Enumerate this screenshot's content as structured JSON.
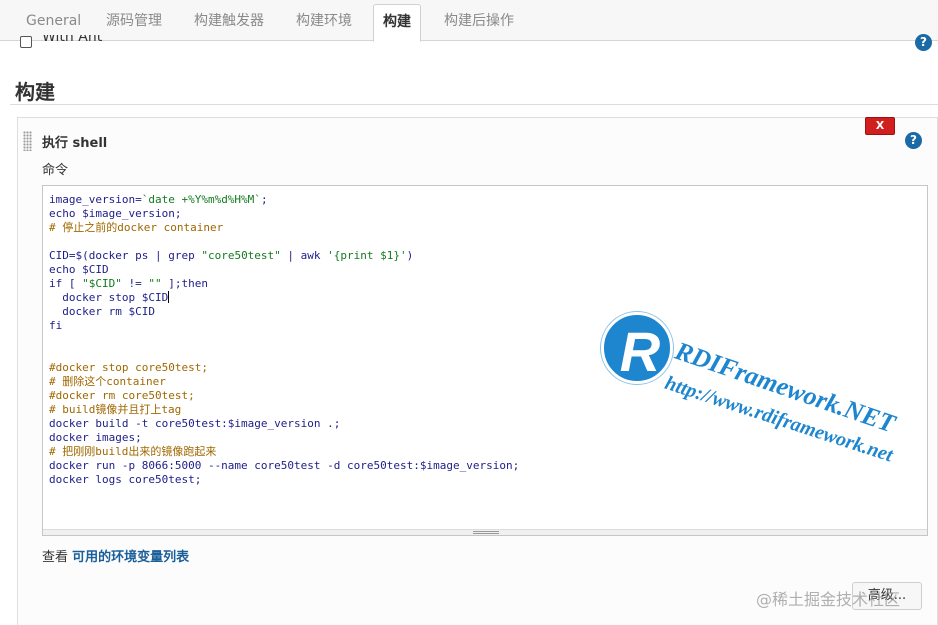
{
  "tabs": [
    {
      "label": "General"
    },
    {
      "label": "源码管理"
    },
    {
      "label": "构建触发器"
    },
    {
      "label": "构建环境"
    },
    {
      "label": "构建"
    },
    {
      "label": "构建后操作"
    }
  ],
  "active_tab": "构建",
  "ant_option": {
    "label": "With Ant",
    "checked": false
  },
  "help_icon": "?",
  "section_title": "构建",
  "build_step": {
    "title": "执行 shell",
    "delete_label": "X",
    "command_label": "命令",
    "command_lines": [
      "image_version=`date +%Y%m%d%H%M`;",
      "echo $image_version;",
      "# 停止之前的docker container",
      "",
      "CID=$(docker ps | grep \"core50test\" | awk '{print $1}')",
      "echo $CID",
      "if [ \"$CID\" != \"\" ];then",
      "  docker stop $CID",
      "  docker rm $CID",
      "fi",
      "",
      "",
      "#docker stop core50test;",
      "# 删除这个container",
      "#docker rm core50test;",
      "# build镜像并且打上tag",
      "docker build -t core50test:$image_version .;",
      "docker images;",
      "# 把刚刚build出来的镜像跑起来",
      "docker run -p 8066:5000 --name core50test -d core50test:$image_version;",
      "docker logs core50test;"
    ],
    "env_prefix": "查看 ",
    "env_link": "可用的环境变量列表",
    "advanced_label": "高级..."
  },
  "watermark": {
    "logo_letter": "R",
    "logo_text": "RDIFramework.NET",
    "logo_url": "http://www.rdiframework.net",
    "site_text": "@稀土掘金技术社区"
  },
  "colors": {
    "help_blue": "#1a6aa6",
    "delete_red": "#d01f1f",
    "link_blue": "#1a5e9a",
    "logo_blue": "#1d86cf"
  }
}
